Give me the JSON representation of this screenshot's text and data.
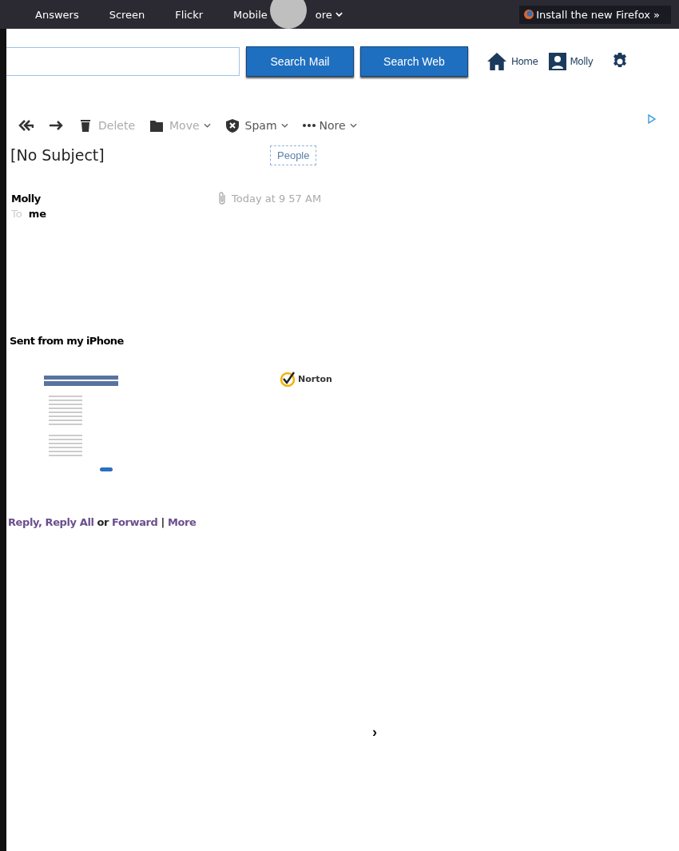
{
  "top_nav": {
    "items": [
      {
        "label": "Answers"
      },
      {
        "label": "Screen"
      },
      {
        "label": "Flickr"
      },
      {
        "label": "Mobile"
      },
      {
        "label": "ore"
      }
    ],
    "promo": "Install the new Firefox »"
  },
  "header": {
    "search_buttons": [
      "Search Mail",
      "Search Web"
    ],
    "home": "Home",
    "user": "Molly"
  },
  "toolbar": {
    "actions": [
      {
        "kind": "reply-all"
      },
      {
        "kind": "forward"
      },
      {
        "kind": "delete",
        "label": "Delete"
      },
      {
        "kind": "move",
        "label": "Move"
      },
      {
        "kind": "spam",
        "label": "Spam"
      },
      {
        "kind": "more",
        "label": "Nore"
      }
    ]
  },
  "message": {
    "subject": "[No Subject]",
    "people_button": "People",
    "sender": "Molly",
    "time": "Today at 9 57 AM",
    "to_label": "To",
    "to": "me",
    "body": "Sent from my iPhone",
    "badge": "Norton"
  },
  "reply_links": [
    {
      "kind": "link",
      "text": "Reply,"
    },
    {
      "kind": "link",
      "text": "Reply All"
    },
    {
      "kind": "plain",
      "text": "or"
    },
    {
      "kind": "link",
      "text": "Forward"
    },
    {
      "kind": "sep",
      "text": "|"
    },
    {
      "kind": "link",
      "text": "More"
    }
  ],
  "pager": "›"
}
